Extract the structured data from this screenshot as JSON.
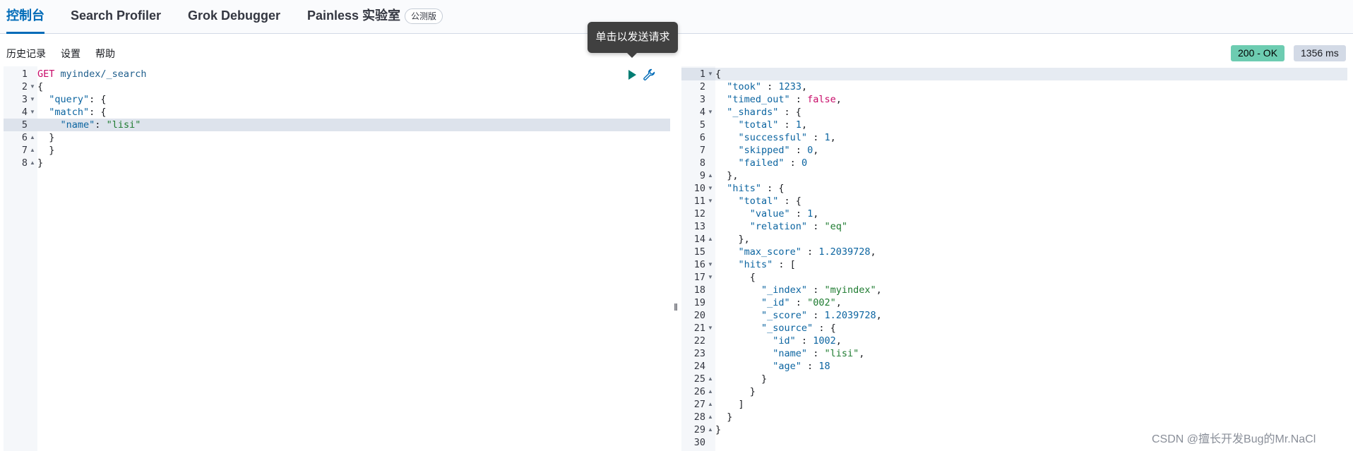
{
  "tabs": [
    {
      "label": "控制台",
      "active": true
    },
    {
      "label": "Search Profiler",
      "active": false
    },
    {
      "label": "Grok Debugger",
      "active": false
    },
    {
      "label": "Painless 实验室",
      "active": false,
      "badge": "公测版"
    }
  ],
  "tooltip": "单击以发送请求",
  "menu": [
    "历史记录",
    "设置",
    "帮助"
  ],
  "status": {
    "code": "200 - OK",
    "time": "1356 ms",
    "ok_color": "#6dccb1"
  },
  "request": {
    "method": "GET",
    "path": "myindex/_search",
    "lines": [
      {
        "n": "1",
        "fold": ""
      },
      {
        "n": "2",
        "fold": "▼"
      },
      {
        "n": "3",
        "fold": "▼"
      },
      {
        "n": "4",
        "fold": "▼"
      },
      {
        "n": "5",
        "fold": ""
      },
      {
        "n": "6",
        "fold": "▲"
      },
      {
        "n": "7",
        "fold": "▲"
      },
      {
        "n": "8",
        "fold": "▲"
      }
    ],
    "body": [
      "{",
      "  \"query\": {",
      "  \"match\": {",
      "    \"name\": \"lisi\"",
      "  }",
      "  }",
      "}"
    ]
  },
  "response": {
    "lines": [
      "{",
      "  \"took\" : 1233,",
      "  \"timed_out\" : false,",
      "  \"_shards\" : {",
      "    \"total\" : 1,",
      "    \"successful\" : 1,",
      "    \"skipped\" : 0,",
      "    \"failed\" : 0",
      "  },",
      "  \"hits\" : {",
      "    \"total\" : {",
      "      \"value\" : 1,",
      "      \"relation\" : \"eq\"",
      "    },",
      "    \"max_score\" : 1.2039728,",
      "    \"hits\" : [",
      "      {",
      "        \"_index\" : \"myindex\",",
      "        \"_id\" : \"002\",",
      "        \"_score\" : 1.2039728,",
      "        \"_source\" : {",
      "          \"id\" : 1002,",
      "          \"name\" : \"lisi\",",
      "          \"age\" : 18",
      "        }",
      "      }",
      "    ]",
      "  }",
      "}",
      ""
    ],
    "folds": [
      "▼",
      "",
      "",
      "▼",
      "",
      "",
      "",
      "",
      "▲",
      "▼",
      "▼",
      "",
      "",
      "▲",
      "",
      "▼",
      "▼",
      "",
      "",
      "",
      "▼",
      "",
      "",
      "",
      "▲",
      "▲",
      "▲",
      "▲",
      "▲",
      ""
    ]
  },
  "watermark": "CSDN @擅长开发Bug的Mr.NaCl",
  "icons": {
    "run": "play-icon",
    "settings": "wrench-icon",
    "resize": "resize-handle-icon"
  }
}
